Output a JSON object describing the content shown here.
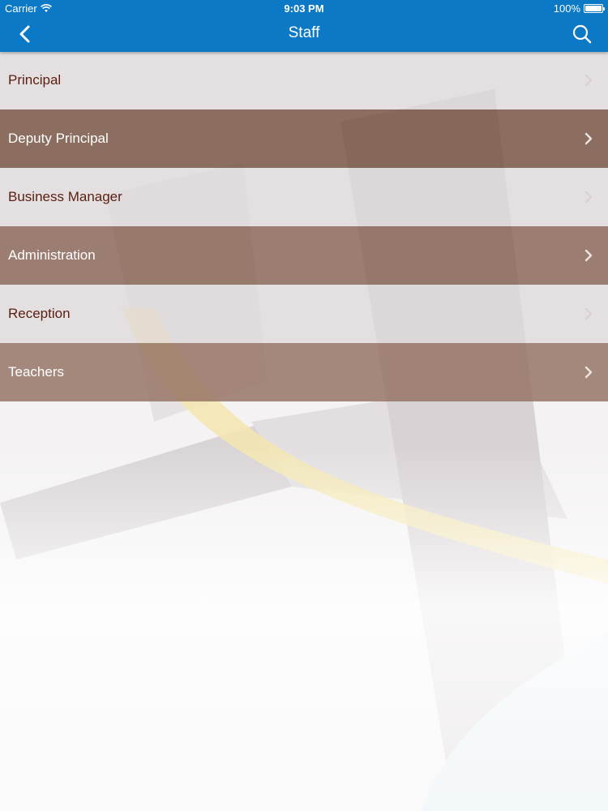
{
  "status_bar": {
    "carrier": "Carrier",
    "time": "9:03 PM",
    "battery": "100%"
  },
  "nav": {
    "title": "Staff",
    "back_icon": "chevron-left-icon",
    "search_icon": "search-icon"
  },
  "list": {
    "items": [
      {
        "label": "Principal"
      },
      {
        "label": "Deputy Principal"
      },
      {
        "label": "Business Manager"
      },
      {
        "label": "Administration"
      },
      {
        "label": "Reception"
      },
      {
        "label": "Teachers"
      }
    ]
  },
  "colors": {
    "accent": "#0b79c6",
    "row_dark": "#7a5646",
    "row_light": "#dcd6d8",
    "row_light_text": "#5a1f10"
  }
}
